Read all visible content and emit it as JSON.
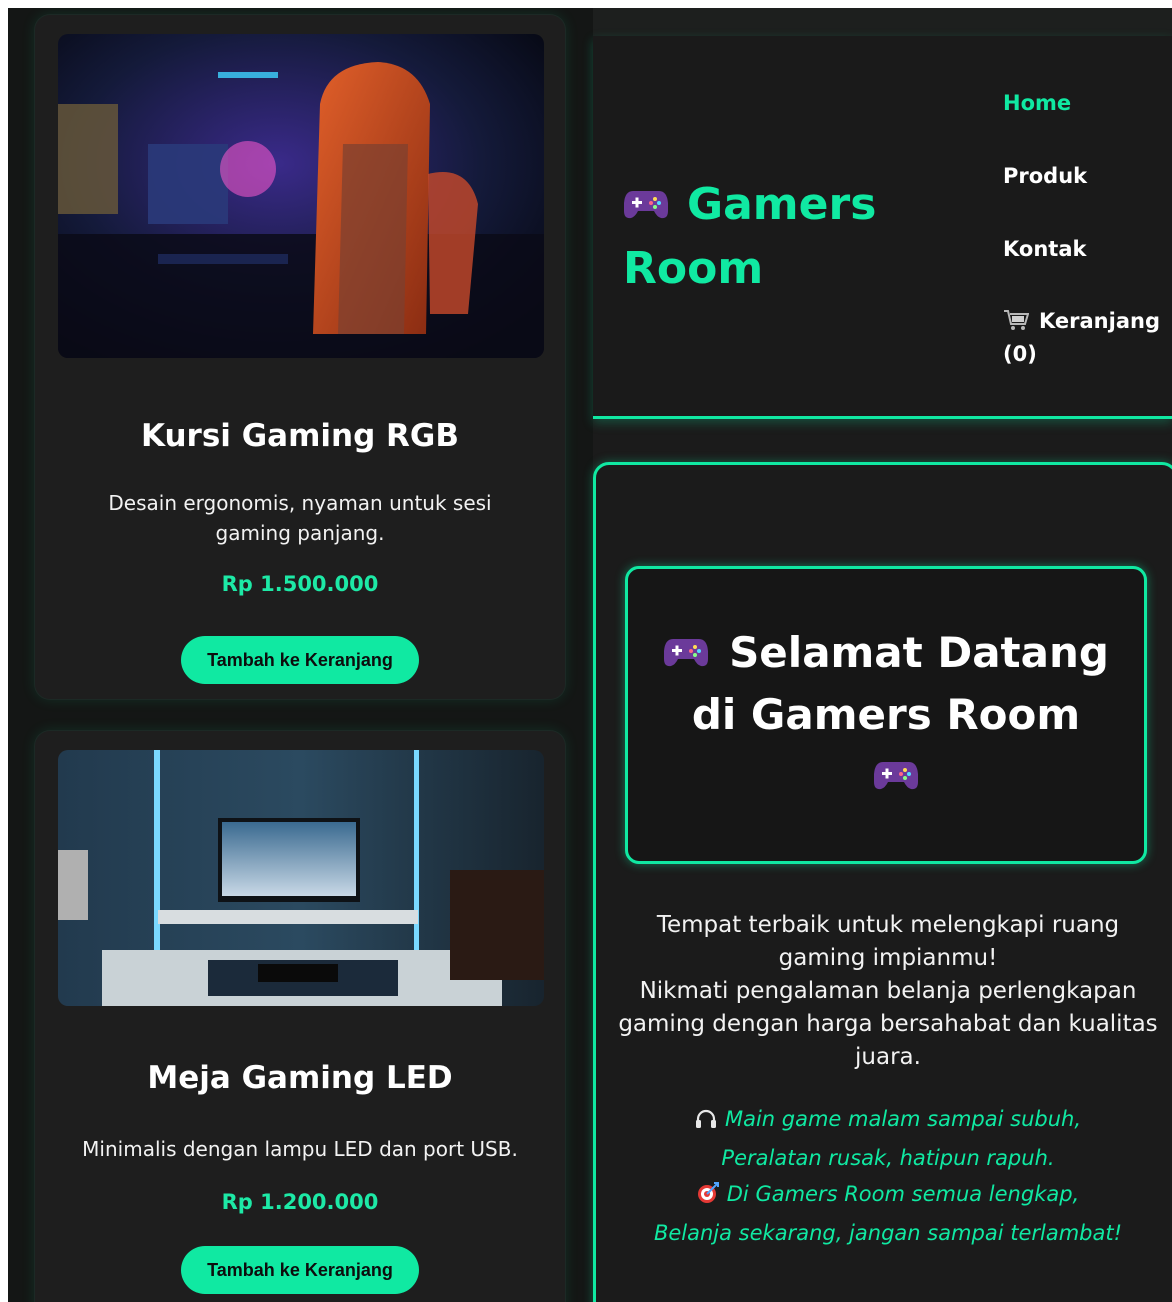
{
  "brand": {
    "line1": "Gamers",
    "line2": "Room",
    "icon": "gamepad-icon",
    "accent": "#10e9a2"
  },
  "nav": {
    "home": "Home",
    "produk": "Produk",
    "kontak": "Kontak",
    "cart_label": "Keranjang",
    "cart_count": "(0)"
  },
  "hero": {
    "title_line1": "Selamat Datang",
    "title_line2": "di Gamers Room",
    "text_line1": "Tempat terbaik untuk melengkapi ruang gaming impianmu!",
    "text_line2": "Nikmati pengalaman belanja perlengkapan gaming dengan harga bersahabat dan kualitas juara.",
    "poem": [
      "Main game malam sampai subuh,",
      "Peralatan rusak, hatipun rapuh.",
      "Di Gamers Room semua lengkap,",
      "Belanja sekarang, jangan sampai terlambat!"
    ]
  },
  "products": [
    {
      "name": "Kursi Gaming RGB",
      "desc": "Desain ergonomis, nyaman untuk sesi gaming panjang.",
      "price": "Rp 1.500.000",
      "button": "Tambah ke Keranjang"
    },
    {
      "name": "Meja Gaming LED",
      "desc": "Minimalis dengan lampu LED dan port USB.",
      "price": "Rp 1.200.000",
      "button": "Tambah ke Keranjang"
    }
  ]
}
